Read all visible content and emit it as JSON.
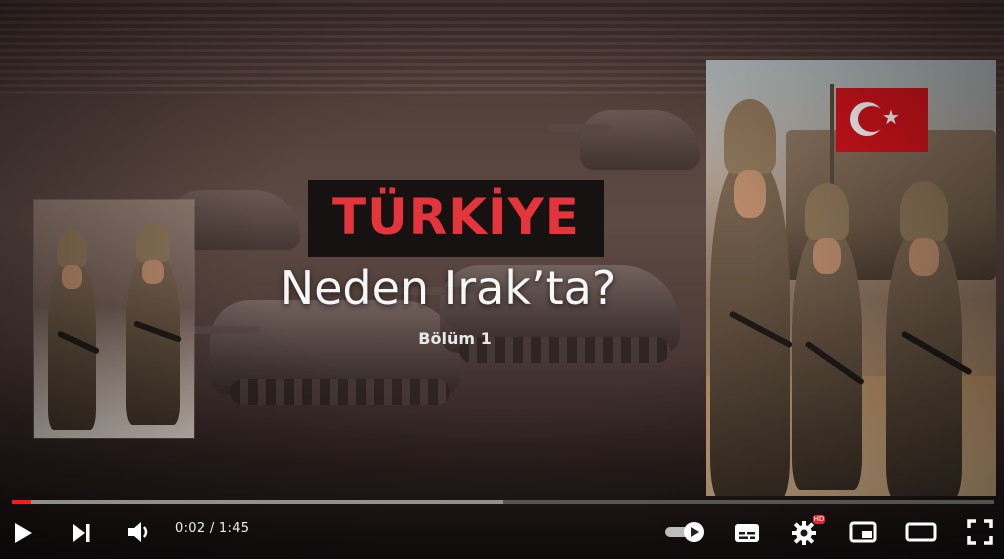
{
  "video": {
    "title_red": "TÜRKİYE",
    "title_white": "Neden Irak’ta?",
    "subtitle": "Bölüm 1",
    "accent_red": "#e4353c",
    "progress_red": "#ff1a1a",
    "played_fraction": 0.019,
    "buffered_fraction": 0.5
  },
  "controls": {
    "time_display": "0:02 / 1:45",
    "play_icon": "play-icon",
    "next_icon": "next-icon",
    "volume_icon": "volume-icon",
    "autoplay_icon": "autoplay-toggle-icon",
    "subtitles_icon": "subtitles-icon",
    "settings_icon": "gear-icon",
    "settings_badge": "HD",
    "miniplayer_icon": "miniplayer-icon",
    "theater_icon": "theater-mode-icon",
    "fullscreen_icon": "fullscreen-icon"
  }
}
